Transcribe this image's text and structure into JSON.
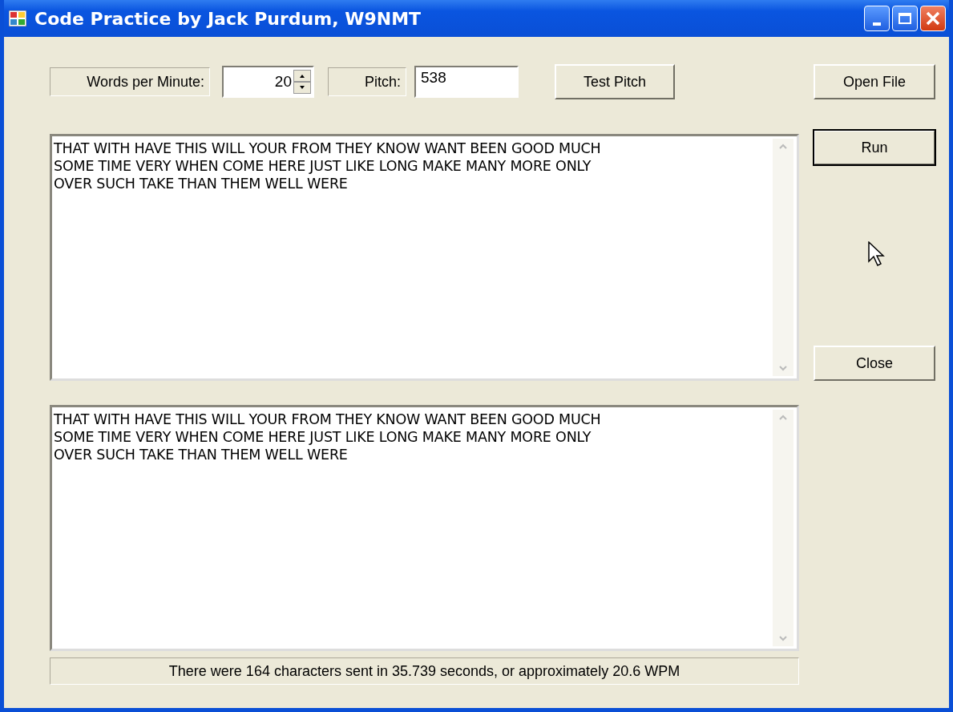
{
  "window": {
    "title": "Code Practice by Jack Purdum, W9NMT"
  },
  "words_per_minute": {
    "label": "Words per Minute:",
    "value": "20"
  },
  "pitch": {
    "label": "Pitch:",
    "value": "538"
  },
  "left_buttons": [
    {
      "label": "Test Pitch",
      "focused": false
    }
  ],
  "right_buttons": [
    {
      "label": "Open File",
      "focused": false,
      "kind": "top"
    },
    {
      "label": "Run",
      "focused": true,
      "kind": "top"
    },
    {
      "label": "Close",
      "focused": false,
      "kind": "lower"
    }
  ],
  "text_boxes": [
    {
      "value": "THAT WITH HAVE THIS WILL YOUR FROM THEY KNOW WANT BEEN GOOD MUCH\nSOME TIME VERY WHEN COME HERE JUST LIKE LONG MAKE MANY MORE ONLY\nOVER SUCH TAKE THAN THEM WELL WERE"
    },
    {
      "value": "THAT WITH HAVE THIS WILL YOUR FROM THEY KNOW WANT BEEN GOOD MUCH\nSOME TIME VERY WHEN COME HERE JUST LIKE LONG MAKE MANY MORE ONLY\nOVER SUCH TAKE THAN THEM WELL WERE"
    }
  ],
  "status": "There were 164 characters sent in 35.739 seconds, or approximately 20.6 WPM"
}
